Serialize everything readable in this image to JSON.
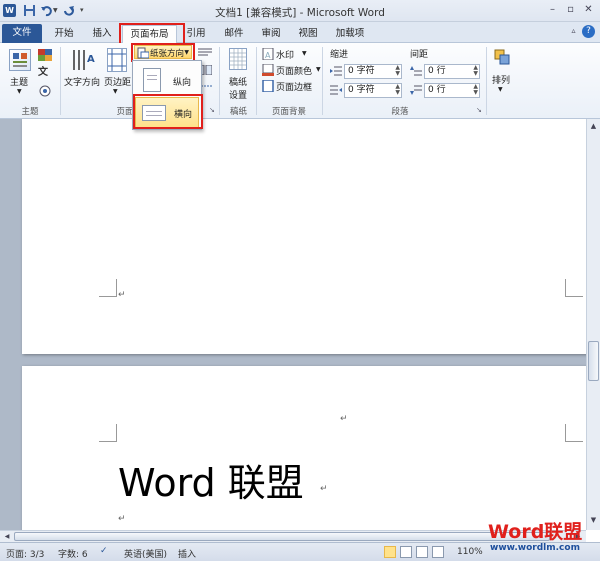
{
  "window": {
    "title": "文档1 [兼容模式] - Microsoft Word"
  },
  "tabs": [
    {
      "label": "文件"
    },
    {
      "label": "开始"
    },
    {
      "label": "插入"
    },
    {
      "label": "页面布局"
    },
    {
      "label": "引用"
    },
    {
      "label": "邮件"
    },
    {
      "label": "审阅"
    },
    {
      "label": "视图"
    },
    {
      "label": "加载项"
    }
  ],
  "ribbon": {
    "themes": {
      "button": "主题",
      "group": "主题"
    },
    "page_setup": {
      "text_direction": "文字方向",
      "margins": "页边距",
      "orientation": "纸张方向",
      "group": "页面"
    },
    "manuscript": {
      "button_line1": "稿纸",
      "button_line2": "设置",
      "group": "稿纸"
    },
    "page_background": {
      "watermark": "水印",
      "page_color": "页面颜色",
      "page_borders": "页面边框",
      "group": "页面背景"
    },
    "paragraph": {
      "indent_label": "缩进",
      "spacing_label": "间距",
      "indent_left": "0 字符",
      "indent_right": "0 字符",
      "spacing_before": "0 行",
      "spacing_after": "0 行",
      "group": "段落"
    },
    "arrange": {
      "button": "排列"
    }
  },
  "orientation_menu": {
    "portrait": "纵向",
    "landscape": "横向"
  },
  "document": {
    "body_text": "Word 联盟",
    "paragraph_mark": "↵"
  },
  "statusbar": {
    "page": "页面: 3/3",
    "words": "字数: 6",
    "language": "英语(美国)",
    "mode": "插入",
    "zoom": "110%"
  },
  "watermark": {
    "brand": "Word联盟",
    "url": "www.wordlm.com"
  },
  "colors": {
    "file_tab": "#2b5797",
    "highlight": "#e0201c",
    "selected_item": "#ffe28b"
  }
}
